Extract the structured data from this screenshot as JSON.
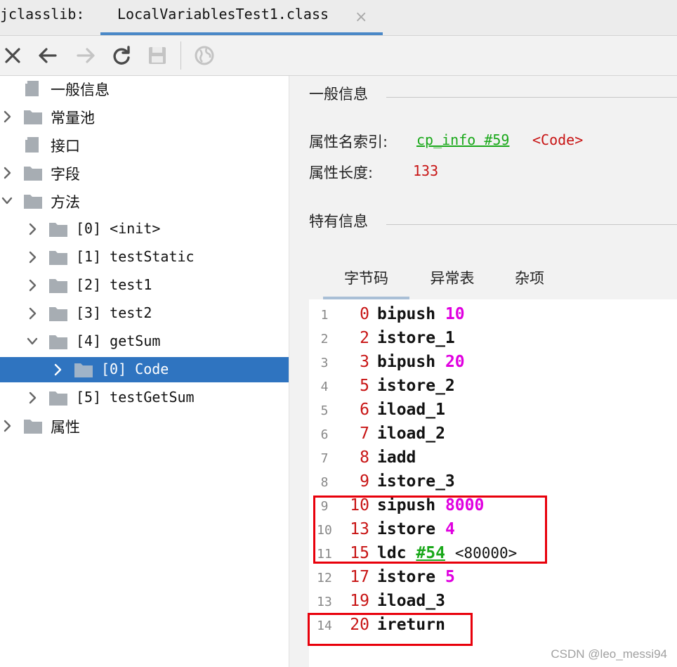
{
  "tabbar": {
    "app_label": "jclasslib:",
    "file_tab": "LocalVariablesTest1.class",
    "close_glyph": "×"
  },
  "toolbar": {
    "icons": [
      "close-icon",
      "back-arrow-icon",
      "forward-arrow-icon",
      "refresh-icon",
      "save-icon",
      "globe-icon"
    ]
  },
  "tree": [
    {
      "label": "一般信息",
      "indent": 0,
      "expander": "none",
      "icon": "file-icon",
      "mono": false
    },
    {
      "label": "常量池",
      "indent": 0,
      "expander": "collapsed",
      "icon": "folder-icon",
      "mono": false
    },
    {
      "label": "接口",
      "indent": 0,
      "expander": "none",
      "icon": "file-icon",
      "mono": false
    },
    {
      "label": "字段",
      "indent": 0,
      "expander": "collapsed",
      "icon": "folder-icon",
      "mono": false
    },
    {
      "label": "方法",
      "indent": 0,
      "expander": "expanded",
      "icon": "folder-icon",
      "mono": false
    },
    {
      "label": "[0] <init>",
      "indent": 1,
      "expander": "collapsed",
      "icon": "folder-icon",
      "mono": true
    },
    {
      "label": "[1] testStatic",
      "indent": 1,
      "expander": "collapsed",
      "icon": "folder-icon",
      "mono": true
    },
    {
      "label": "[2] test1",
      "indent": 1,
      "expander": "collapsed",
      "icon": "folder-icon",
      "mono": true
    },
    {
      "label": "[3] test2",
      "indent": 1,
      "expander": "collapsed",
      "icon": "folder-icon",
      "mono": true
    },
    {
      "label": "[4] getSum",
      "indent": 1,
      "expander": "expanded",
      "icon": "folder-icon",
      "mono": true
    },
    {
      "label": "[0] Code",
      "indent": 2,
      "expander": "collapsed",
      "icon": "folder-icon",
      "mono": true,
      "selected": true
    },
    {
      "label": "[5] testGetSum",
      "indent": 1,
      "expander": "collapsed",
      "icon": "folder-icon",
      "mono": true
    },
    {
      "label": "属性",
      "indent": 0,
      "expander": "collapsed",
      "icon": "folder-icon",
      "mono": false
    }
  ],
  "detail": {
    "general_title": "一般信息",
    "attr_name_key": "属性名索引:",
    "attr_name_link": "cp_info #59",
    "attr_name_tag": "<Code>",
    "attr_len_key": "属性长度:",
    "attr_len_value": "133",
    "specific_title": "特有信息",
    "subtabs": [
      {
        "label": "字节码",
        "active": true
      },
      {
        "label": "异常表",
        "active": false
      },
      {
        "label": "杂项",
        "active": false
      }
    ]
  },
  "bytecode": [
    {
      "line": "1",
      "offset": "0",
      "op": "bipush",
      "arg": "10",
      "arg_color": "pink",
      "comment": ""
    },
    {
      "line": "2",
      "offset": "2",
      "op": "istore_1",
      "arg": "",
      "arg_color": "",
      "comment": ""
    },
    {
      "line": "3",
      "offset": "3",
      "op": "bipush",
      "arg": "20",
      "arg_color": "pink",
      "comment": ""
    },
    {
      "line": "4",
      "offset": "5",
      "op": "istore_2",
      "arg": "",
      "arg_color": "",
      "comment": ""
    },
    {
      "line": "5",
      "offset": "6",
      "op": "iload_1",
      "arg": "",
      "arg_color": "",
      "comment": ""
    },
    {
      "line": "6",
      "offset": "7",
      "op": "iload_2",
      "arg": "",
      "arg_color": "",
      "comment": ""
    },
    {
      "line": "7",
      "offset": "8",
      "op": "iadd",
      "arg": "",
      "arg_color": "",
      "comment": ""
    },
    {
      "line": "8",
      "offset": "9",
      "op": "istore_3",
      "arg": "",
      "arg_color": "",
      "comment": ""
    },
    {
      "line": "9",
      "offset": "10",
      "op": "sipush",
      "arg": "8000",
      "arg_color": "pink",
      "comment": ""
    },
    {
      "line": "10",
      "offset": "13",
      "op": "istore",
      "arg": "4",
      "arg_color": "pink",
      "comment": ""
    },
    {
      "line": "11",
      "offset": "15",
      "op": "ldc",
      "arg": "#54",
      "arg_color": "green",
      "comment": "<80000>"
    },
    {
      "line": "12",
      "offset": "17",
      "op": "istore",
      "arg": "5",
      "arg_color": "pink",
      "comment": ""
    },
    {
      "line": "13",
      "offset": "19",
      "op": "iload_3",
      "arg": "",
      "arg_color": "",
      "comment": ""
    },
    {
      "line": "14",
      "offset": "20",
      "op": "ireturn",
      "arg": "",
      "arg_color": "",
      "comment": ""
    }
  ],
  "colors": {
    "selection": "#2f74c0",
    "offset": "#c81414",
    "constant": "#e000e0",
    "cp_ref": "#1aa81a",
    "highlight_box": "#e8000b"
  },
  "watermark": "CSDN @leo_messi94"
}
